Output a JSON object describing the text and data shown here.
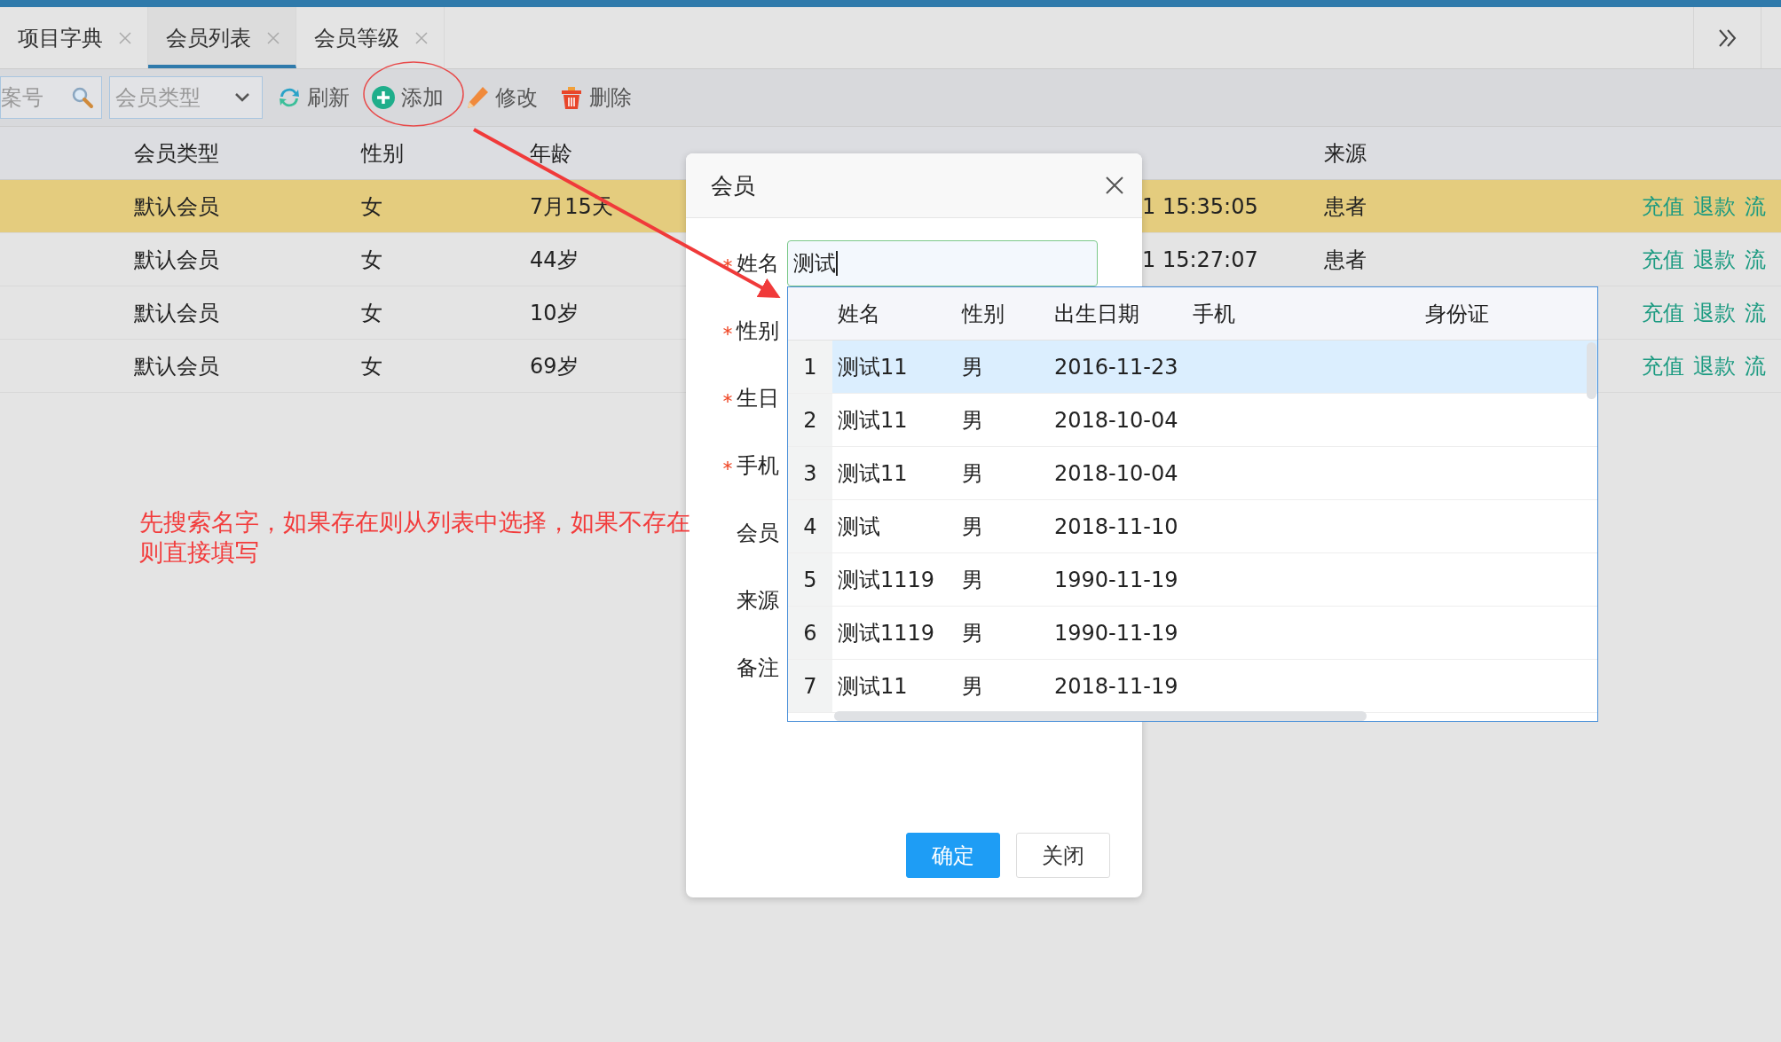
{
  "tabs": [
    {
      "label": "项目字典",
      "selected": false
    },
    {
      "label": "会员列表",
      "selected": true
    },
    {
      "label": "会员等级",
      "selected": false
    }
  ],
  "toolbar": {
    "search": {
      "placeholder": "案号"
    },
    "type_select": {
      "placeholder": "会员类型"
    },
    "buttons": [
      {
        "label": "刷新",
        "kind": "refresh"
      },
      {
        "label": "添加",
        "kind": "add"
      },
      {
        "label": "修改",
        "kind": "edit"
      },
      {
        "label": "删除",
        "kind": "delete"
      }
    ]
  },
  "table": {
    "columns": [
      "会员类型",
      "性别",
      "年龄",
      "来源"
    ],
    "rows": [
      {
        "type": "默认会员",
        "gender": "女",
        "age": "7月15天",
        "time": "1 15:35:05",
        "source": "患者",
        "actions": [
          "充值",
          "退款",
          "流"
        ],
        "selected": true
      },
      {
        "type": "默认会员",
        "gender": "女",
        "age": "44岁",
        "time": "1 15:27:07",
        "source": "患者",
        "actions": [
          "充值",
          "退款",
          "流"
        ],
        "selected": false
      },
      {
        "type": "默认会员",
        "gender": "女",
        "age": "10岁",
        "actions": [
          "充值",
          "退款",
          "流"
        ],
        "selected": false
      },
      {
        "type": "默认会员",
        "gender": "女",
        "age": "69岁",
        "actions": [
          "充值",
          "退款",
          "流"
        ],
        "selected": false
      }
    ]
  },
  "annotation": {
    "text": "先搜索名字，如果存在则从列表中选择，如果不存在则直接填写"
  },
  "dialog": {
    "title": "会员",
    "fields": [
      {
        "label": "姓名",
        "required": true,
        "value": "测试"
      },
      {
        "label": "性别",
        "required": true
      },
      {
        "label": "生日",
        "required": true
      },
      {
        "label": "手机",
        "required": true
      },
      {
        "label": "会员",
        "required": false
      },
      {
        "label": "来源",
        "required": false
      },
      {
        "label": "备注",
        "required": false
      }
    ],
    "suggestions": {
      "columns": [
        "姓名",
        "性别",
        "出生日期",
        "手机",
        "身份证"
      ],
      "rows": [
        {
          "index": "1",
          "name": "测试11",
          "gender": "男",
          "birth": "2016-11-23",
          "selected": true
        },
        {
          "index": "2",
          "name": "测试11",
          "gender": "男",
          "birth": "2018-10-04",
          "selected": false
        },
        {
          "index": "3",
          "name": "测试11",
          "gender": "男",
          "birth": "2018-10-04",
          "selected": false
        },
        {
          "index": "4",
          "name": "测试",
          "gender": "男",
          "birth": "2018-11-10",
          "selected": false
        },
        {
          "index": "5",
          "name": "测试1119",
          "gender": "男",
          "birth": "1990-11-19",
          "selected": false
        },
        {
          "index": "6",
          "name": "测试1119",
          "gender": "男",
          "birth": "1990-11-19",
          "selected": false
        },
        {
          "index": "7",
          "name": "测试11",
          "gender": "男",
          "birth": "2018-11-19",
          "selected": false
        }
      ]
    },
    "buttons": [
      {
        "label": "确定",
        "kind": "primary"
      },
      {
        "label": "关闭",
        "kind": "default"
      }
    ]
  }
}
